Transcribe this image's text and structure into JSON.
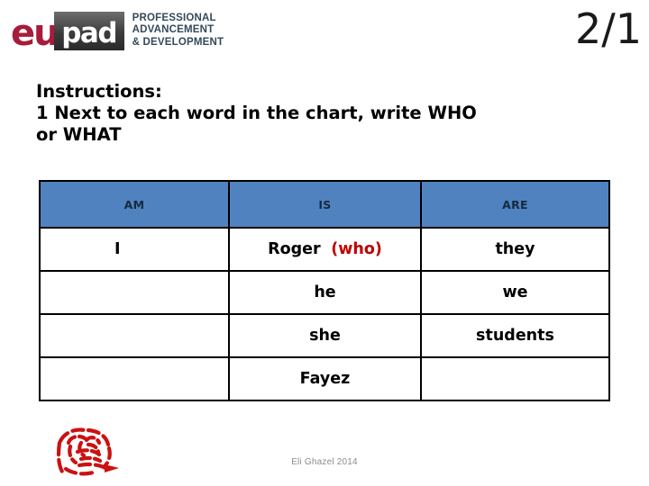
{
  "brand": {
    "logo_eu": "eu",
    "logo_pad": "pad",
    "tagline_line1": "PROFESSIONAL",
    "tagline_line2": "ADVANCEMENT",
    "tagline_line3": "& DEVELOPMENT",
    "eu_color": "#a81b3a",
    "tagline_color": "#34495b"
  },
  "page_number": "2/1",
  "instructions": {
    "heading": "Instructions:",
    "line1": "1 Next to each word in the chart, write WHO",
    "line2": "or WHAT"
  },
  "chart_data": {
    "type": "table",
    "title": "",
    "header_bg": "#5182c0",
    "header_text_color": "#152a42",
    "answer_color": "#c00000",
    "columns": [
      "AM",
      "IS",
      "ARE"
    ],
    "rows": [
      {
        "am": "I",
        "is": "Roger",
        "is_answer": "(who)",
        "are": "they"
      },
      {
        "am": "",
        "is": "he",
        "is_answer": "",
        "are": "we"
      },
      {
        "am": "",
        "is": "she",
        "is_answer": "",
        "are": "students"
      },
      {
        "am": "",
        "is": "Fayez",
        "is_answer": "",
        "are": ""
      }
    ]
  },
  "footer": {
    "credit": "Eli Ghazel 2014",
    "doodle_color": "#cc1111"
  }
}
